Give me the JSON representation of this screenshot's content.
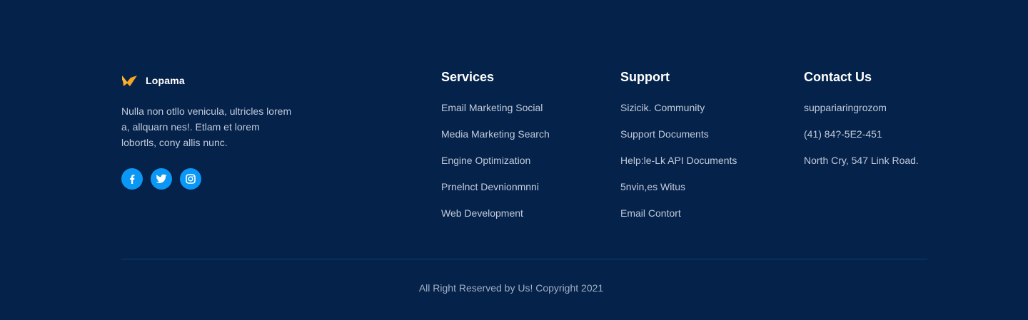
{
  "brand": {
    "name": "Lopama",
    "logo_icon": "m-logo-icon",
    "logo_color": "#f5a623",
    "description": "Nulla non otllo venicula, ultricles lorem a, allquarn nes!. Etlam et lorem lobortls, cony allis nunc."
  },
  "socials": [
    {
      "icon": "facebook-icon",
      "color": "#0b97f5"
    },
    {
      "icon": "twitter-icon",
      "color": "#0b97f5"
    },
    {
      "icon": "instagram-icon",
      "color": "#0b97f5"
    }
  ],
  "services": {
    "title": "Services",
    "items": [
      "Email Marketing Social",
      "Media Marketing Search",
      "Engine Optimization",
      "Prnelnct Devnionmnni",
      "Web Development"
    ]
  },
  "support": {
    "title": "Support",
    "items": [
      "Sizicik. Community",
      "Support Documents",
      "Help:le-Lk API Documents",
      "5nvin,es Witus",
      "Email Contort"
    ]
  },
  "contact": {
    "title": "Contact Us",
    "items": [
      "suppariaringrozom",
      "(41) 84?-5E2-451",
      "North Cry, 547 Link Road."
    ]
  },
  "footer": {
    "copyright": "All Right Reserved by Us! Copyright 2021"
  },
  "colors": {
    "background": "#04224a",
    "accent": "#0b97f5",
    "divider": "#123a7a"
  }
}
